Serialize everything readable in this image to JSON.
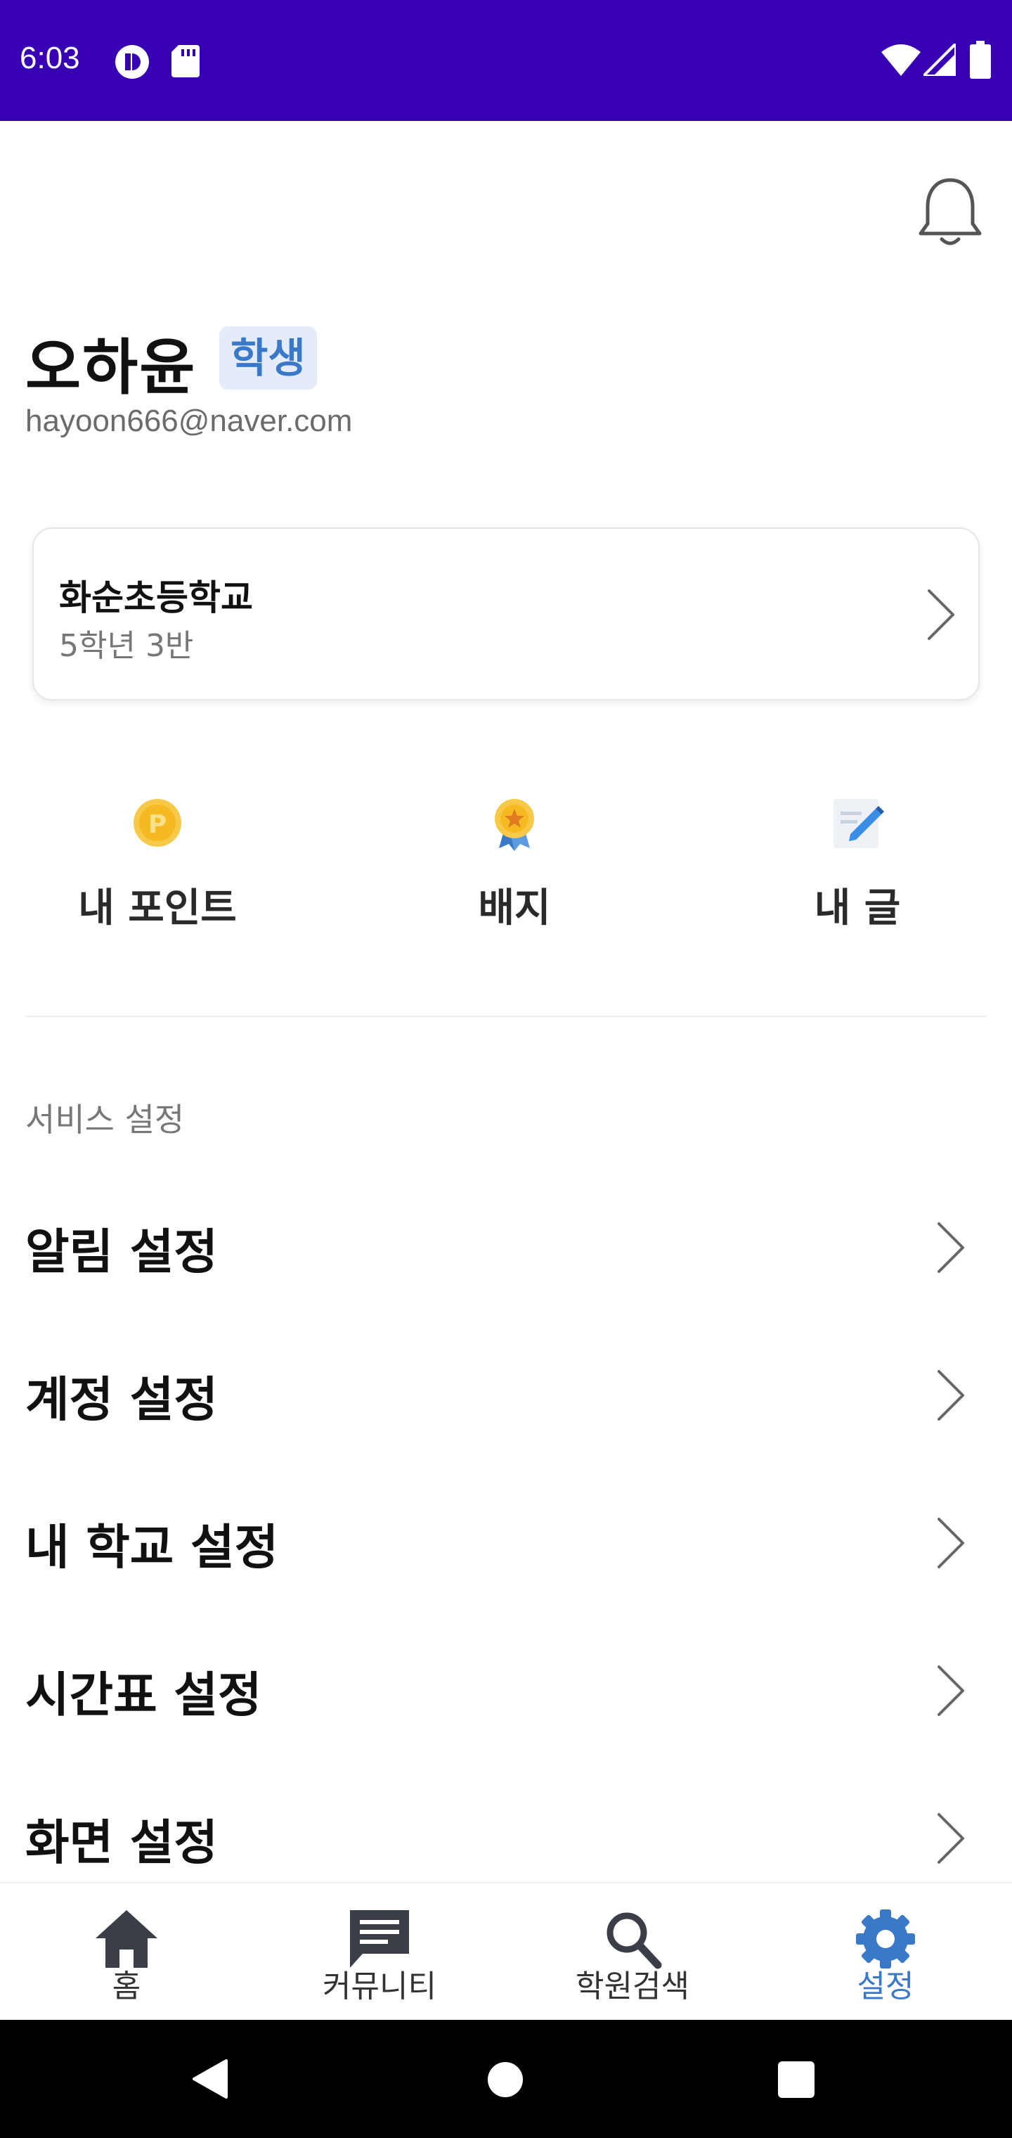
{
  "status_bar": {
    "time": "6:03",
    "icons": [
      "app-notification-icon",
      "sd-card-icon",
      "wifi-icon",
      "cell-signal-icon",
      "battery-icon"
    ],
    "background": "#3700b3"
  },
  "header": {
    "notification_icon": "bell-icon"
  },
  "profile": {
    "name": "오하윤",
    "role": "학생",
    "email": "hayoon666@naver.com"
  },
  "school": {
    "name": "화순초등학교",
    "class": "5학년 3반"
  },
  "quick_actions": [
    {
      "label": "내 포인트",
      "icon": "point-coin-icon"
    },
    {
      "label": "배지",
      "icon": "badge-medal-icon"
    },
    {
      "label": "내 글",
      "icon": "my-posts-pencil-icon"
    }
  ],
  "section_title": "서비스 설정",
  "menu": [
    {
      "label": "알림 설정"
    },
    {
      "label": "계정 설정"
    },
    {
      "label": "내 학교 설정"
    },
    {
      "label": "시간표 설정"
    },
    {
      "label": "화면 설정"
    }
  ],
  "bottom_nav": [
    {
      "label": "홈",
      "icon": "home-icon",
      "active": false
    },
    {
      "label": "커뮤니티",
      "icon": "chat-bubble-icon",
      "active": false
    },
    {
      "label": "학원검색",
      "icon": "search-icon",
      "active": false
    },
    {
      "label": "설정",
      "icon": "gear-icon",
      "active": true
    }
  ],
  "colors": {
    "accent": "#3a78c8",
    "status_bar": "#3700b3",
    "badge_bg": "#e3ecf8",
    "nav_icon": "#333333"
  }
}
